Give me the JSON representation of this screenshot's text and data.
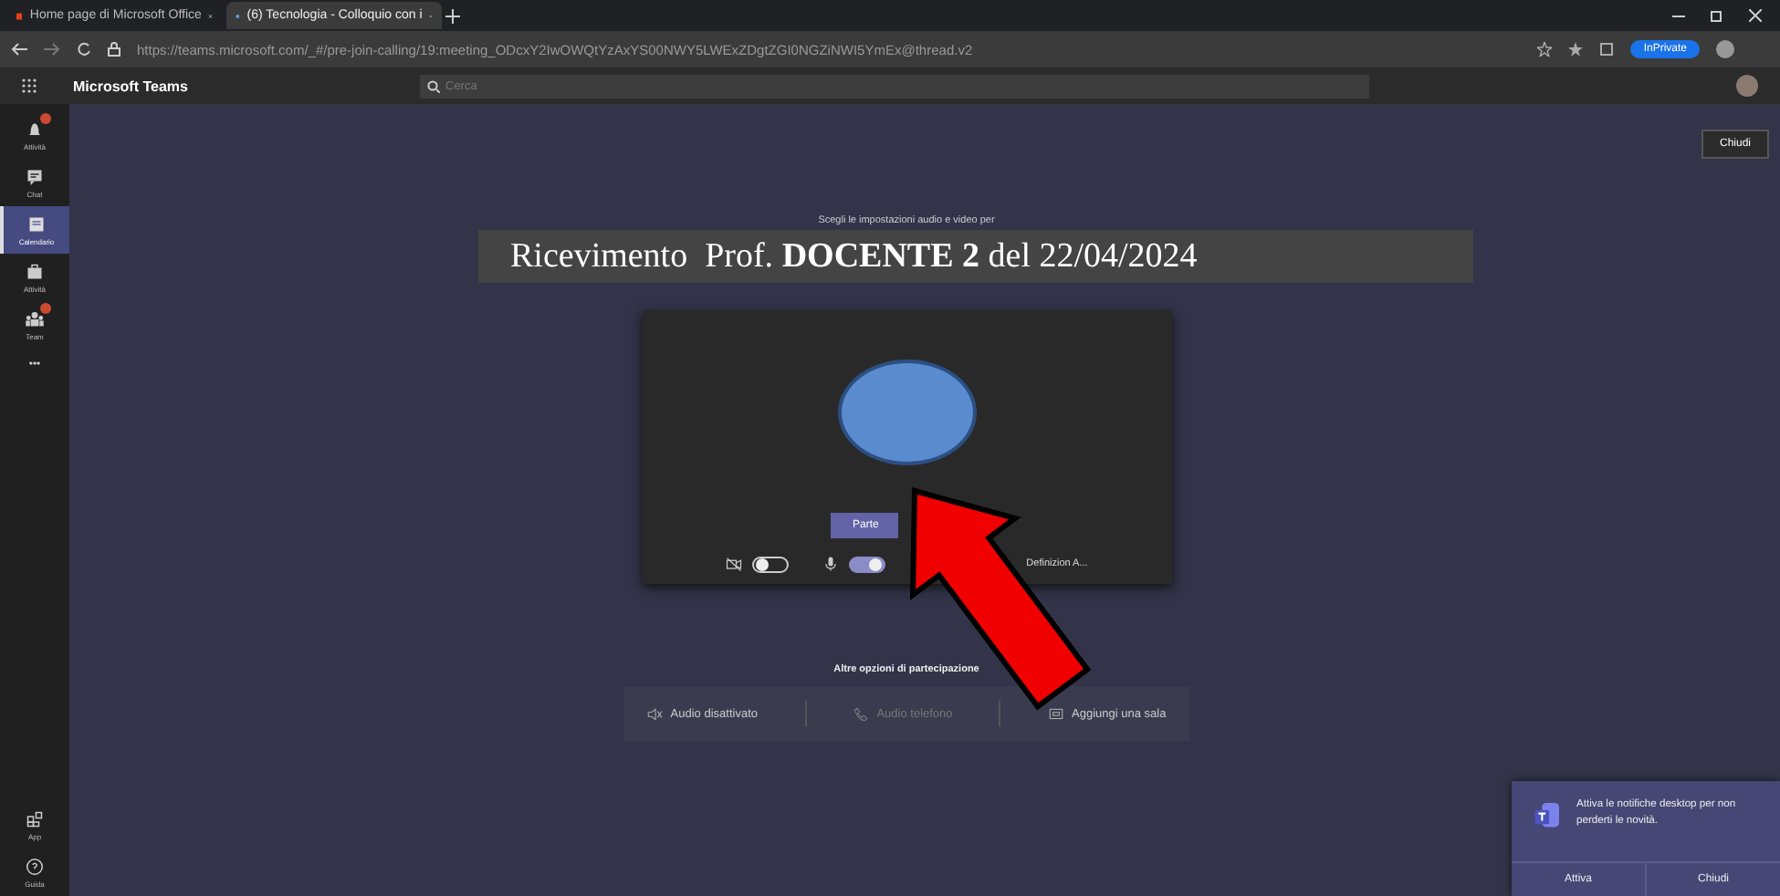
{
  "browser": {
    "tabs": [
      {
        "title": "Home page di Microsoft Office",
        "selected": false
      },
      {
        "title": "(6) Tecnologia - Colloquio con i",
        "selected": true
      }
    ],
    "url": "https://teams.microsoft.com/_#/pre-join-calling/19:meeting_ODcxY2IwOWQtYzAxYS00NWY5LWExZDgtZGI0NGZiNWI5YmEx@thread.v2",
    "inprivate": "InPrivate"
  },
  "app": {
    "title": "Microsoft Teams",
    "search": {
      "placeholder": "Cerca"
    }
  },
  "rail": {
    "items": [
      {
        "label": "Attività",
        "kind": "bell",
        "badge": true,
        "selected": false
      },
      {
        "label": "Chat",
        "kind": "chat",
        "badge": false,
        "selected": false
      },
      {
        "label": "Calendario",
        "kind": "calendar",
        "badge": false,
        "selected": true
      },
      {
        "label": "Attività",
        "kind": "bag",
        "badge": false,
        "selected": false
      },
      {
        "label": "Team",
        "kind": "team",
        "badge": true,
        "selected": false
      }
    ],
    "more": "•••",
    "bottom": [
      {
        "label": "App",
        "kind": "apps"
      },
      {
        "label": "Guida",
        "kind": "help"
      }
    ]
  },
  "close_button": "Chiudi",
  "prejoin": {
    "subtitle": "Scegli le impostazioni audio e video per",
    "meeting_title": "Ricevimento  Prof. **DOCENTE 2** del 22/04/2024",
    "join_button": "Parte",
    "controls": [
      {
        "kind": "camera",
        "on": false
      },
      {
        "kind": "mic",
        "on": true
      }
    ],
    "device": "Definizion A...",
    "other_heading": "Altre opzioni di partecipazione",
    "options": [
      {
        "label": "Audio disattivato",
        "kind": "speaker",
        "disabled": false
      },
      {
        "label": "Audio telefono",
        "kind": "phone",
        "disabled": true
      },
      {
        "label": "Aggiungi una sala",
        "kind": "room",
        "disabled": false
      }
    ]
  },
  "toast": {
    "message": "Attiva le notifiche desktop per non perderti le novità.",
    "buttons": [
      "Attiva",
      "Chiudi"
    ]
  }
}
